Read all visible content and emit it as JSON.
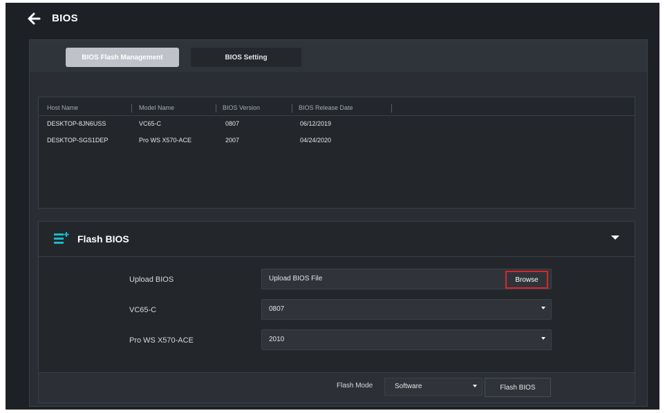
{
  "header": {
    "back_icon": "arrow-left-icon",
    "title": "BIOS"
  },
  "tabs": [
    {
      "label": "BIOS Flash Management",
      "active": true
    },
    {
      "label": "BIOS Setting",
      "active": false
    }
  ],
  "table": {
    "columns": [
      "Host Name",
      "Model Name",
      "BIOS Version",
      "BIOS Release Date"
    ],
    "rows": [
      [
        "DESKTOP-8JN6USS",
        "VC65-C",
        "0807",
        "06/12/2019"
      ],
      [
        "DESKTOP-SGS1DEP",
        "Pro WS X570-ACE",
        "2007",
        "04/24/2020"
      ]
    ]
  },
  "flash_bios": {
    "icon": "list-plus-icon",
    "title": "Flash BIOS",
    "upload_label": "Upload BIOS",
    "upload_placeholder": "Upload BIOS File",
    "browse_label": "Browse",
    "devices": [
      {
        "label": "VC65-C",
        "value": "0807"
      },
      {
        "label": "Pro WS X570-ACE",
        "value": "2010"
      }
    ],
    "flash_mode_label": "Flash Mode",
    "flash_mode_value": "Software",
    "flash_button": "Flash BIOS"
  },
  "colors": {
    "background": "#1d2126",
    "panel": "#2a2e34",
    "highlight": "#d8262a",
    "icon_accent": "#19b9c9"
  }
}
